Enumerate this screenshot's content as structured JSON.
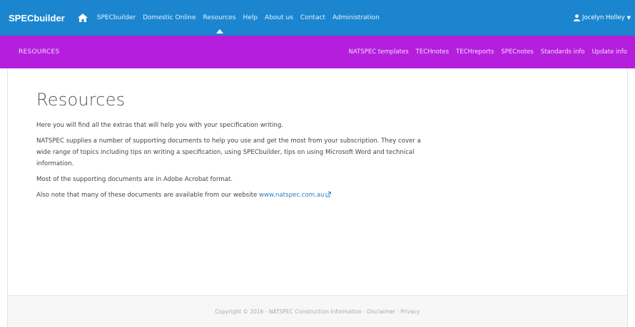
{
  "header": {
    "brand": "SPECbuilder",
    "nav_items": [
      {
        "label": "SPECbuilder",
        "active": false
      },
      {
        "label": "Domestic Online",
        "active": false
      },
      {
        "label": "Resources",
        "active": true
      },
      {
        "label": "Help",
        "active": false
      },
      {
        "label": "About us",
        "active": false
      },
      {
        "label": "Contact",
        "active": false
      },
      {
        "label": "Administration",
        "active": false
      }
    ],
    "user_name": "Jocelyn Holley",
    "colors": {
      "topbar": "#1b86cf",
      "subbar": "#b61ede"
    }
  },
  "subheader": {
    "section": "RESOURCES",
    "items": [
      "NATSPEC templates",
      "TECHnotes",
      "TECHreports",
      "SPECnotes",
      "Standards info",
      "Update info"
    ]
  },
  "main": {
    "title": "Resources",
    "para1": "Here you will find all the extras that will help you with your specification writing.",
    "para2": "NATSPEC supplies a number of supporting documents to help you use and get the most from your subscription. They cover a wide range of topics including tips on writing a specification, using SPECbuilder, tips on using Microsoft Word and technical information.",
    "para3": "Most of the supporting documents are in Adobe Acrobat format.",
    "para4_prefix": "Also note that many of these documents are available from our website",
    "website_link": "www.natspec.com.au"
  },
  "footer": {
    "text": "Copyright © 2016 - NATSPEC Construction Information - Disclaimer - Privacy"
  }
}
